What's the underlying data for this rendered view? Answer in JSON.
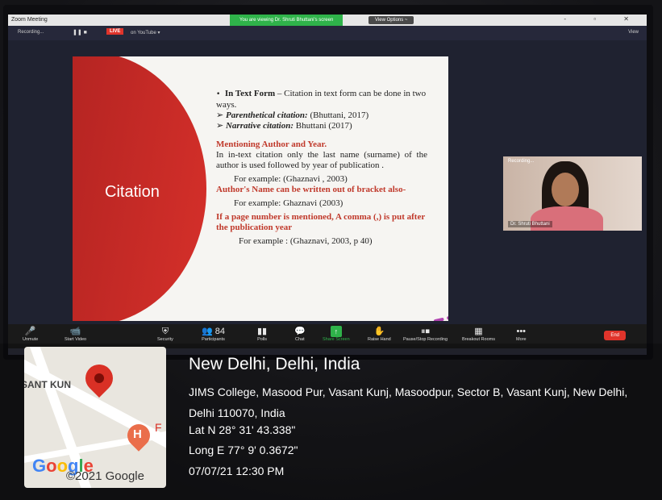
{
  "window": {
    "app_title": "Zoom Meeting",
    "viewing_banner": "You are viewing Dr. Shruti Bhuttani's screen",
    "view_options": "View Options ~",
    "controls": "-  ▫  ✕"
  },
  "recording_bar": {
    "recording": "Recording...",
    "live_badge": "LIVE",
    "live_target": "on YouTube ▾",
    "view_btn": "View"
  },
  "slide": {
    "title": "Citation",
    "bullet_heading": "In Text Form",
    "bullet_text": " – Citation in text form  can be done in two ways.",
    "sub1_label": "Parenthetical citation:",
    "sub1_value": " (Bhuttani, 2017)",
    "sub2_label": "Narrative citation:",
    "sub2_value": " Bhuttani (2017)",
    "heading2": "Mentioning Author and Year.",
    "para": "In in-text citation only the last name (surname) of the author is used followed by year of publication .",
    "example1": "For example: (Ghaznavi , 2003)",
    "heading3": "Author's Name can be written out of bracket also-",
    "example2": "For example: Ghaznavi (2003)",
    "heading4": "If a page number is mentioned, A comma (,) is put after the publication year",
    "example3": "For example : (Ghaznavi, 2003, p 40)"
  },
  "video_tile": {
    "top_name": "Recording...",
    "name": "Dr. Shruti Bhuttani"
  },
  "toolbar": {
    "items": [
      {
        "label": "Unmute",
        "icon": "mic-icon",
        "glyph": "🎤"
      },
      {
        "label": "Start Video",
        "icon": "camera-icon",
        "glyph": "📹"
      },
      {
        "label": "Security",
        "icon": "shield-icon",
        "glyph": "⛨"
      },
      {
        "label": "Participants",
        "icon": "participants-icon",
        "glyph": "👥 84"
      },
      {
        "label": "Polls",
        "icon": "polls-icon",
        "glyph": "▮▮"
      },
      {
        "label": "Chat",
        "icon": "chat-icon",
        "glyph": "💬"
      },
      {
        "label": "Share Screen",
        "icon": "share-screen-icon",
        "glyph": "↑"
      },
      {
        "label": "Raise Hand",
        "icon": "hand-icon",
        "glyph": "✋"
      },
      {
        "label": "Pause/Stop Recording",
        "icon": "record-icon",
        "glyph": "⏸⏹"
      },
      {
        "label": "Breakout Rooms",
        "icon": "breakout-icon",
        "glyph": "▦"
      },
      {
        "label": "More",
        "icon": "more-icon",
        "glyph": "•••"
      }
    ],
    "end_label": "End"
  },
  "geotag": {
    "city": "New Delhi, Delhi, India",
    "address": "JIMS College, Masood Pur, Vasant Kunj, Masoodpur, Sector B, Vasant Kunj, New Delhi, Delhi 110070, India",
    "lat": "Lat N 28° 31' 43.338\"",
    "long": "Long E 77° 9' 0.3672\"",
    "datetime": "07/07/21 12:30 PM"
  },
  "map": {
    "area_label": "SANT KUN",
    "h_letter": "H",
    "f_letter": "F",
    "logo": "Google",
    "copyright": "©2021 Google"
  }
}
